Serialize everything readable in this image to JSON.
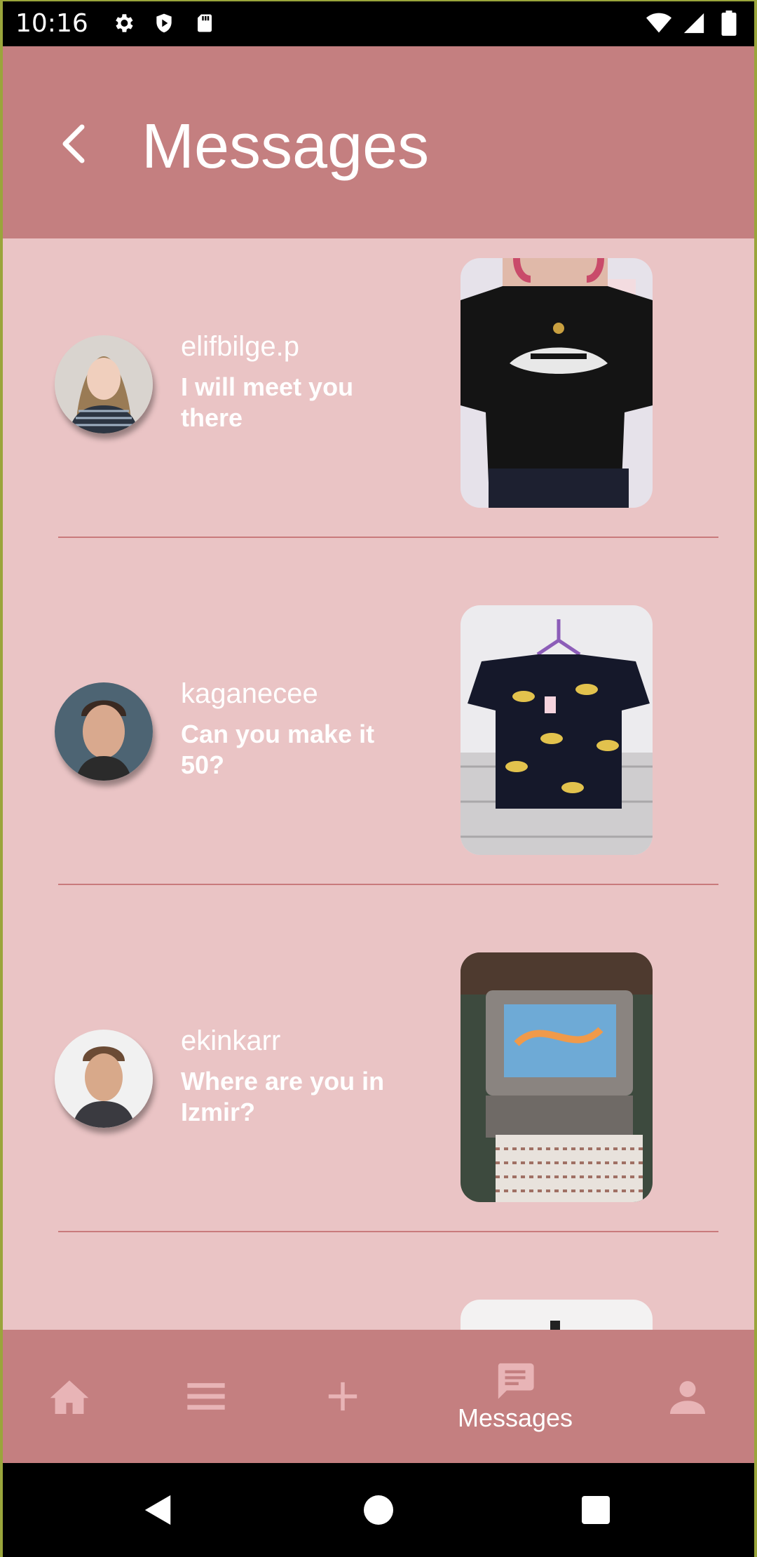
{
  "status_bar": {
    "time": "10:16",
    "icons_left": [
      "gear-icon",
      "shield-icon",
      "sd-card-icon"
    ],
    "icons_right": [
      "wifi-icon",
      "signal-icon",
      "battery-icon"
    ]
  },
  "header": {
    "title": "Messages",
    "back_icon": "chevron-left-icon",
    "background": "#c47f80"
  },
  "messages": [
    {
      "username": "elifbilge.p",
      "preview": "I will meet you there",
      "avatar": "female-avatar",
      "thumbnail": "black-vans-tshirt-photo"
    },
    {
      "username": "kaganecee",
      "preview": "Can you make it 50?",
      "avatar": "male-avatar",
      "thumbnail": "unicorn-print-tshirt-photo"
    },
    {
      "username": "ekinkarr",
      "preview": "Where are you in Izmir?",
      "avatar": "male-avatar-2",
      "thumbnail": "retro-tv-photo"
    }
  ],
  "bottom_nav": {
    "items": [
      {
        "icon": "home-icon",
        "label": "",
        "active": false
      },
      {
        "icon": "menu-icon",
        "label": "",
        "active": false
      },
      {
        "icon": "plus-icon",
        "label": "",
        "active": false
      },
      {
        "icon": "chat-icon",
        "label": "Messages",
        "active": true
      },
      {
        "icon": "person-icon",
        "label": "",
        "active": false
      }
    ]
  },
  "colors": {
    "accent": "#c47f80",
    "background": "#eac4c5",
    "divider": "#c97a7c"
  }
}
